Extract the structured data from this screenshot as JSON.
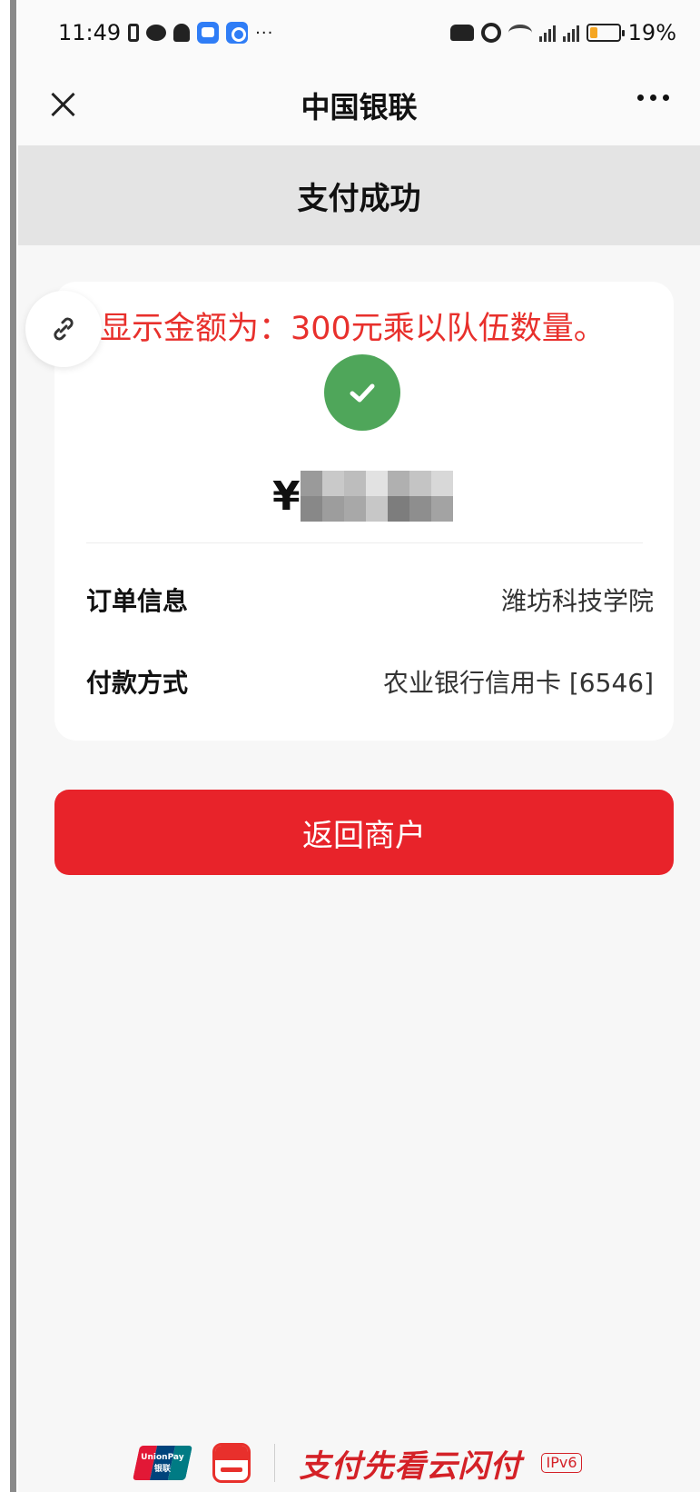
{
  "status_bar": {
    "time": "11:49",
    "more": "···",
    "battery": "19%"
  },
  "nav": {
    "title": "中国银联"
  },
  "header": {
    "title": "支付成功"
  },
  "annotation": "显示金额为：300元乘以队伍数量。",
  "payment": {
    "currency": "¥",
    "rows": [
      {
        "label": "订单信息",
        "value": "潍坊科技学院"
      },
      {
        "label": "付款方式",
        "value": "农业银行信用卡 [6546]"
      }
    ]
  },
  "button": {
    "label": "返回商户"
  },
  "footer": {
    "unionpay": "UnionPay 银联",
    "slogan": "支付先看云闪付",
    "badge": "IPv6"
  },
  "colors": {
    "primary_red": "#e8232a",
    "success_green": "#4fa65a",
    "annotation_red": "#e8302c",
    "band_gray": "#e4e4e4"
  },
  "icons": [
    "close-icon",
    "more-icon",
    "link-icon",
    "check-icon"
  ]
}
